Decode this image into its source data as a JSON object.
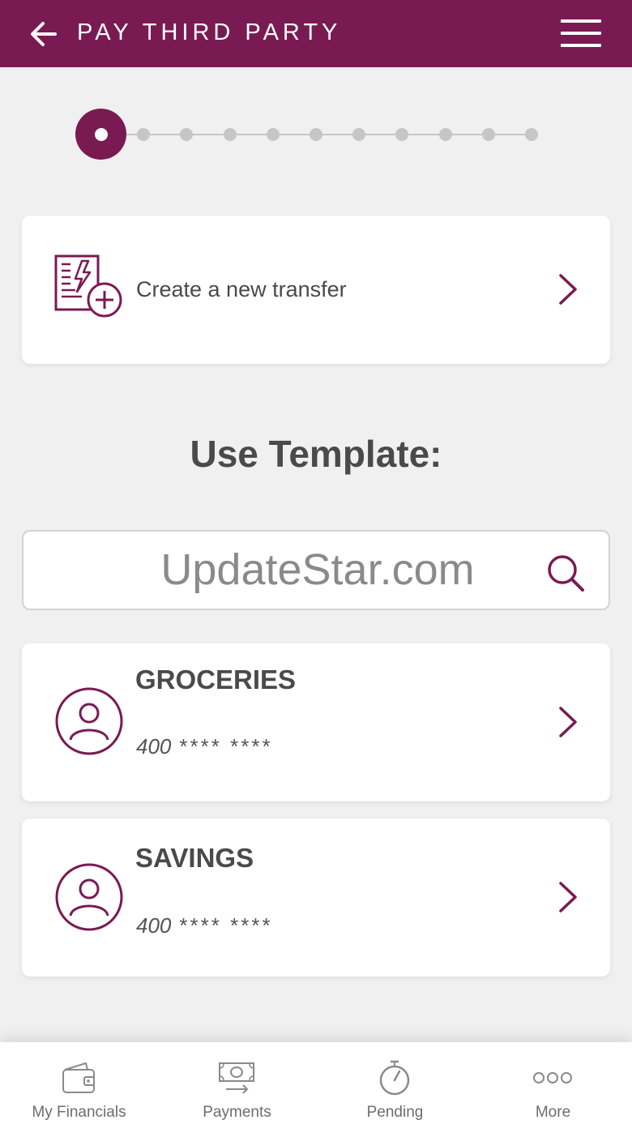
{
  "header": {
    "title": "PAY THIRD PARTY",
    "back_icon": "arrow-left-icon",
    "menu_icon": "hamburger-menu-icon"
  },
  "stepper": {
    "total_steps": 11,
    "current_step": 1
  },
  "new_transfer": {
    "label": "Create a new transfer",
    "icon": "new-invoice-icon"
  },
  "section_title": "Use Template:",
  "search": {
    "placeholder": "UpdateStar.com",
    "icon": "search-icon"
  },
  "templates": [
    {
      "name": "GROCERIES",
      "account_prefix": "400",
      "account_mask": "**** ****"
    },
    {
      "name": "SAVINGS",
      "account_prefix": "400",
      "account_mask": "**** ****"
    }
  ],
  "bottom_nav": [
    {
      "label": "My Financials",
      "icon": "wallet-icon"
    },
    {
      "label": "Payments",
      "icon": "banknote-transfer-icon"
    },
    {
      "label": "Pending",
      "icon": "stopwatch-icon"
    },
    {
      "label": "More",
      "icon": "more-dots-icon"
    }
  ],
  "colors": {
    "brand": "#7a1a52",
    "background": "#f0f0f0",
    "text": "#4a4a4a",
    "muted": "#c6c6c6"
  }
}
